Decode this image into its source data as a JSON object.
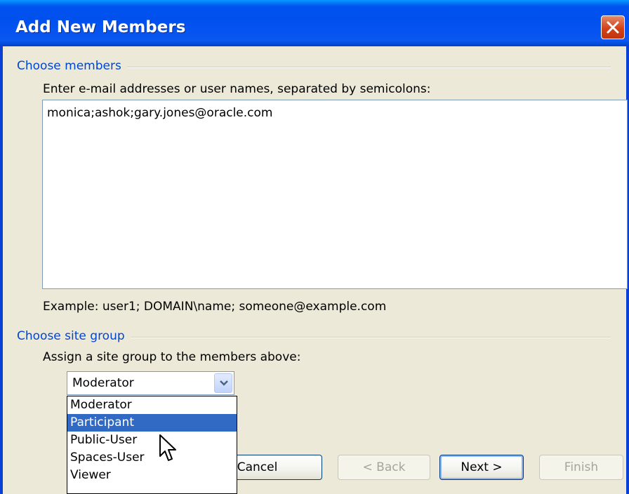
{
  "window": {
    "title": "Add New Members"
  },
  "choose_members": {
    "heading": "Choose members",
    "instruction": "Enter e-mail addresses or user names, separated by semicolons:",
    "value": "monica;ashok;gary.jones@oracle.com",
    "example": "Example: user1; DOMAIN\\name; someone@example.com"
  },
  "choose_site_group": {
    "heading": "Choose site group",
    "instruction": "Assign a site group to the members above:",
    "selected": "Moderator",
    "options": [
      "Moderator",
      "Participant",
      "Public-User",
      "Spaces-User",
      "Viewer"
    ],
    "highlighted": "Participant"
  },
  "buttons": {
    "cancel": "Cancel",
    "back": "< Back",
    "next": "Next >",
    "finish": "Finish"
  }
}
